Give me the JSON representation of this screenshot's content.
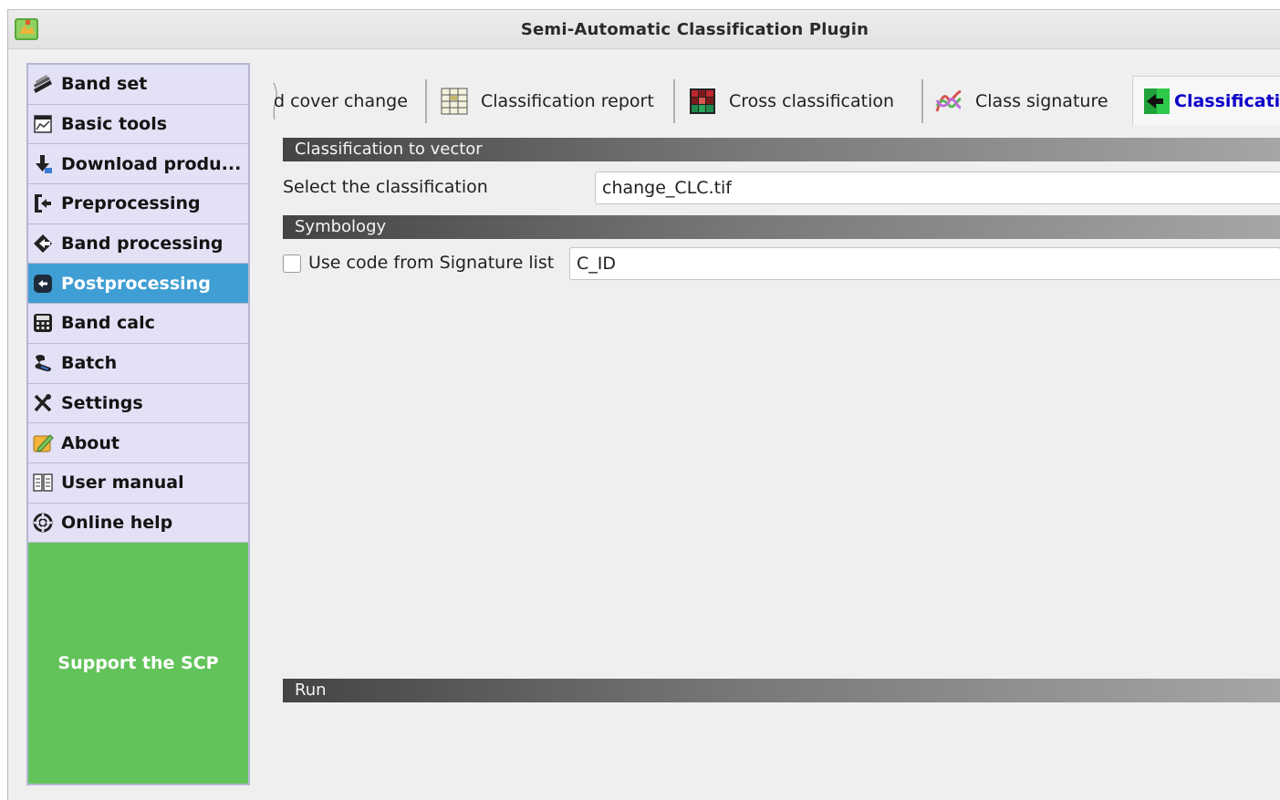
{
  "window": {
    "title": "Semi-Automatic Classification Plugin"
  },
  "sidebar": {
    "items": [
      {
        "label": "Band set",
        "icon": "band-set-icon"
      },
      {
        "label": "Basic tools",
        "icon": "basic-tools-icon"
      },
      {
        "label": "Download produ...",
        "icon": "download-icon"
      },
      {
        "label": "Preprocessing",
        "icon": "preprocessing-icon"
      },
      {
        "label": "Band processing",
        "icon": "band-processing-icon"
      },
      {
        "label": "Postprocessing",
        "icon": "postprocessing-icon",
        "active": true
      },
      {
        "label": "Band calc",
        "icon": "calculator-icon"
      },
      {
        "label": "Batch",
        "icon": "batch-icon"
      },
      {
        "label": "Settings",
        "icon": "settings-icon"
      },
      {
        "label": "About",
        "icon": "about-icon"
      },
      {
        "label": "User manual",
        "icon": "user-manual-icon"
      },
      {
        "label": "Online help",
        "icon": "online-help-icon"
      }
    ],
    "support_label": "Support the SCP"
  },
  "tabs": [
    {
      "label": "d cover change",
      "icon": "",
      "active": false
    },
    {
      "label": "Classification report",
      "icon": "classification-report-icon",
      "active": false
    },
    {
      "label": "Cross classification",
      "icon": "cross-classification-icon",
      "active": false
    },
    {
      "label": "Class signature",
      "icon": "class-signature-icon",
      "active": false
    },
    {
      "label": "Classificatio",
      "icon": "classification-to-vector-icon",
      "active": true
    }
  ],
  "main": {
    "section_classification": "Classification to vector",
    "select_label": "Select the classification",
    "select_value": "change_CLC.tif",
    "section_symbology": "Symbology",
    "use_code_label": "Use code from Signature list",
    "use_code_checked": false,
    "code_value": "C_ID",
    "section_run": "Run"
  },
  "colors": {
    "sidebar_bg": "#e2e1f6",
    "sidebar_active": "#3f9ed3",
    "support_bg": "#62c35b",
    "active_tab_text": "#0c00c8"
  }
}
